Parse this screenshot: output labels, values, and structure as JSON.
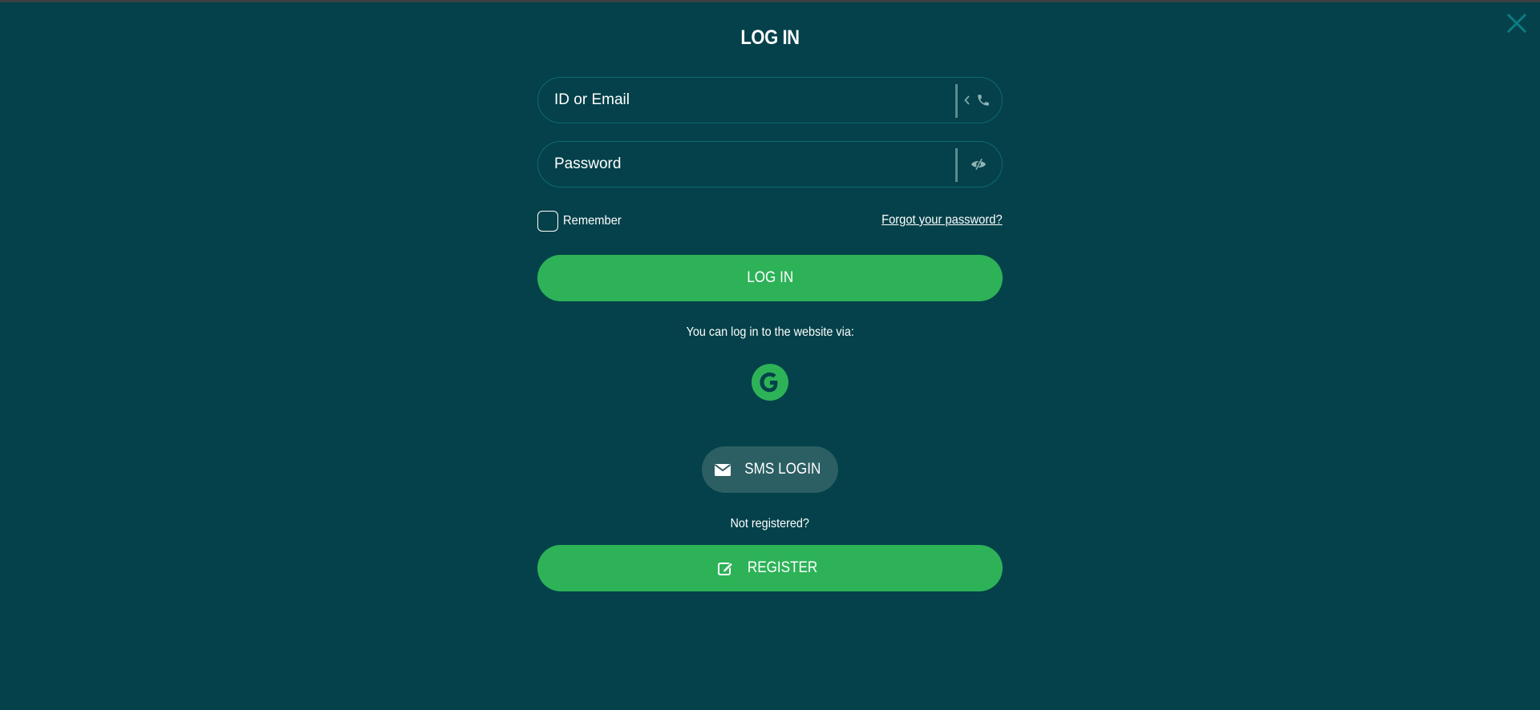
{
  "modal": {
    "title": "LOG IN",
    "close_icon": "close-icon"
  },
  "form": {
    "id_field": {
      "placeholder": "ID or Email",
      "value": "",
      "icons": [
        "chevron-left-icon",
        "phone-icon"
      ]
    },
    "password_field": {
      "placeholder": "Password",
      "value": "",
      "icons": [
        "eye-slash-icon"
      ]
    },
    "remember": {
      "label": "Remember",
      "checked": false
    },
    "forgot_link": "Forgot your password?",
    "login_button": "LOG IN"
  },
  "social": {
    "caption": "You can log in to the website via:",
    "providers": [
      {
        "name": "Google",
        "icon": "google-icon",
        "color": "#2db258"
      }
    ]
  },
  "sms_button": {
    "label": "SMS LOGIN",
    "icon": "envelope-icon"
  },
  "register": {
    "caption": "Not registered?",
    "button": "REGISTER",
    "icon": "edit-icon"
  },
  "colors": {
    "background": "#04414a",
    "accent": "#2db258",
    "field_border": "#0f6a72",
    "sms_button": "#2c5f63"
  }
}
